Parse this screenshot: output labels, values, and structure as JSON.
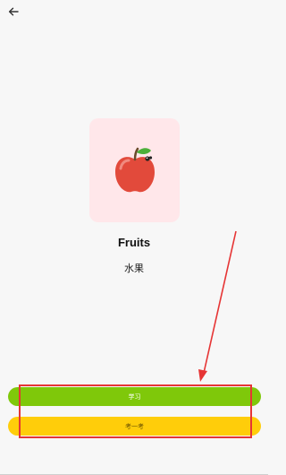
{
  "nav": {
    "back_icon": "arrow-left-icon"
  },
  "card": {
    "background": "#ffe7ea",
    "image": "apple-icon"
  },
  "word": {
    "english": "Fruits",
    "chinese": "水果"
  },
  "buttons": {
    "learn_label": "学习",
    "learn_color": "#7fc80a",
    "test_label": "考一考",
    "test_color": "#ffcd0a"
  },
  "annotation": {
    "color": "#e63535"
  }
}
